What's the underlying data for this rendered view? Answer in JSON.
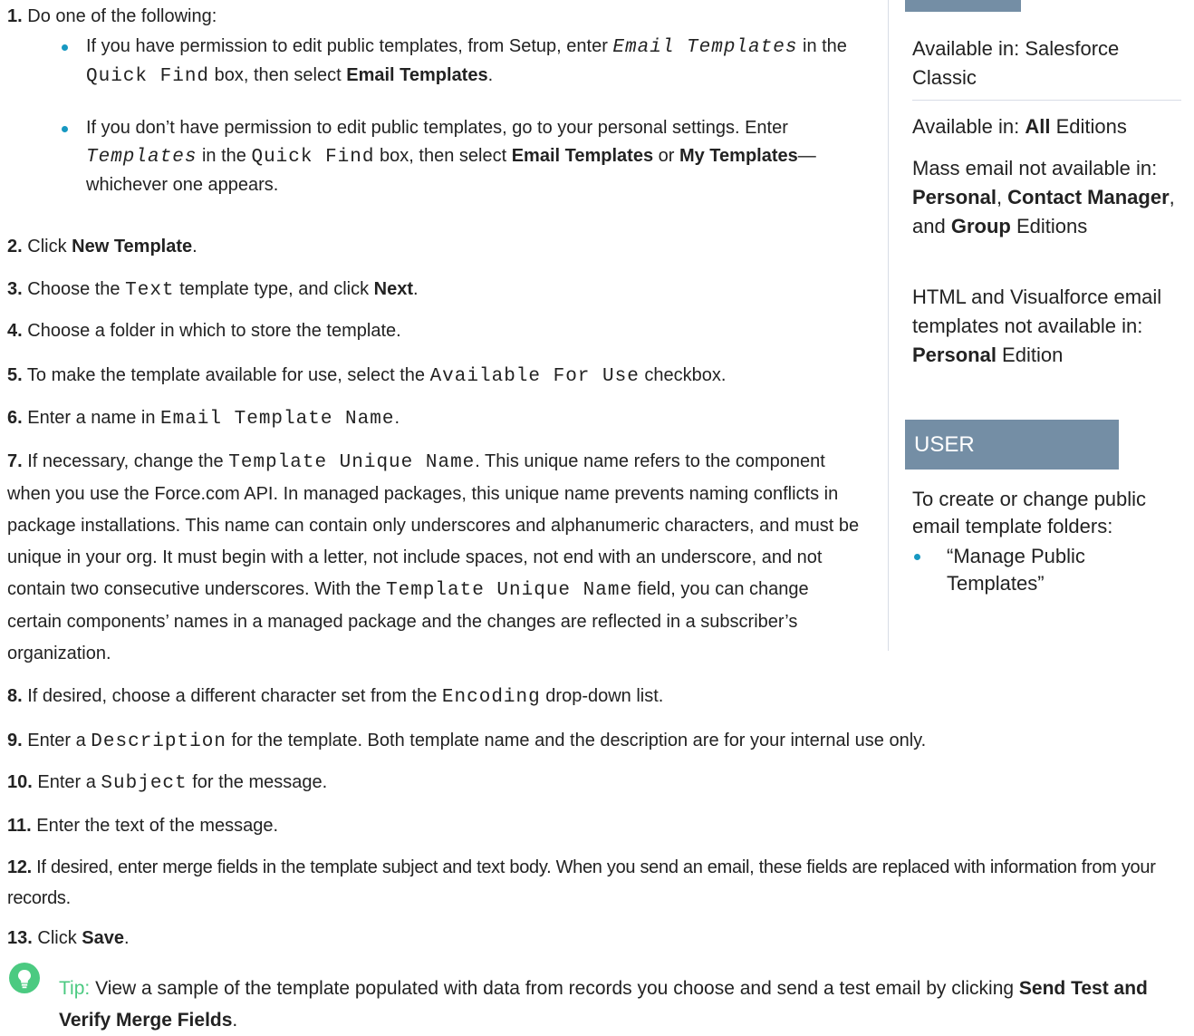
{
  "steps": [
    {
      "num": "1.",
      "text": "Do one of the following:"
    },
    {
      "num": "2.",
      "pre": "Click ",
      "bold": "New Template",
      "post": "."
    },
    {
      "num": "3.",
      "pre": "Choose the ",
      "code": "Text",
      "mid": " template type, and click ",
      "bold": "Next",
      "post": "."
    },
    {
      "num": "4.",
      "text": "Choose a folder in which to store the template."
    },
    {
      "num": "5.",
      "pre": "To make the template available for use, select the ",
      "code": "Available For Use",
      "post": " checkbox."
    },
    {
      "num": "6.",
      "pre": "Enter a name in ",
      "code": "Email Template Name",
      "post": "."
    },
    {
      "num": "7.",
      "pre": "If necessary, change the ",
      "code": "Template Unique Name",
      "mid": ". This unique name refers to the component when you use the Force.com API. In managed packages, this unique name prevents naming conflicts in package installations. This name can contain only underscores and alphanumeric characters, and must be unique in your org. It must begin with a letter, not include spaces, not end with an underscore, and not contain two consecutive underscores. With the ",
      "code2": "Template Unique Name",
      "post": " field, you can change certain components’ names in a managed package and the changes are reflected in a subscriber’s organization."
    },
    {
      "num": "8.",
      "pre": "If desired, choose a different character set from the ",
      "code": "Encoding",
      "post": " drop-down list."
    },
    {
      "num": "9.",
      "pre": "Enter a ",
      "code": "Description",
      "post": " for the template. Both template name and the description are for your internal use only."
    },
    {
      "num": "10.",
      "pre": "Enter a ",
      "code": "Subject",
      "post": " for the message."
    },
    {
      "num": "11.",
      "text": "Enter the text of the message."
    },
    {
      "num": "12.",
      "text": "If desired, enter merge fields in the template subject and text body. When you send an email, these fields are replaced with information from your records."
    },
    {
      "num": "13.",
      "pre": "Click ",
      "bold": "Save",
      "post": "."
    }
  ],
  "substeps": [
    {
      "pre": "If you have permission to edit public templates, from Setup, enter ",
      "code": "Email Templates",
      "mid": " in the ",
      "code2": "Quick Find",
      "mid2": " box, then select ",
      "bold": "Email Templates",
      "post": "."
    },
    {
      "pre": "If you don’t have permission to edit public templates, go to your personal settings. Enter ",
      "code": "Templates",
      "mid": " in the ",
      "code2": "Quick Find",
      "mid2": " box, then select ",
      "bold": "Email Templates",
      "mid3": " or ",
      "bold2": "My Templates",
      "post": "—whichever one appears."
    }
  ],
  "sidebar": {
    "available_in": "Available in: Salesforce Classic",
    "editions_pre": "Available in: ",
    "editions_bold": "All",
    "editions_post": " Editions",
    "mass_pre": "Mass email not available in: ",
    "mass_b1": "Personal",
    "mass_sep1": ", ",
    "mass_b2": "Contact Manager",
    "mass_sep2": ", and ",
    "mass_b3": "Group",
    "mass_post": " Editions",
    "html_pre": "HTML and Visualforce email templates not available in: ",
    "html_bold": "Personal",
    "html_post": " Edition",
    "perm_header": "USER PERMISSIONS",
    "perm_text": "To create or change public email template folders:",
    "perm_item": "“Manage Public Templates”"
  },
  "tip": {
    "label": "Tip:",
    "pre": " View a sample of the template populated with data from records you choose and send a test email by clicking ",
    "bold": "Send Test and Verify Merge Fields",
    "post": "."
  }
}
